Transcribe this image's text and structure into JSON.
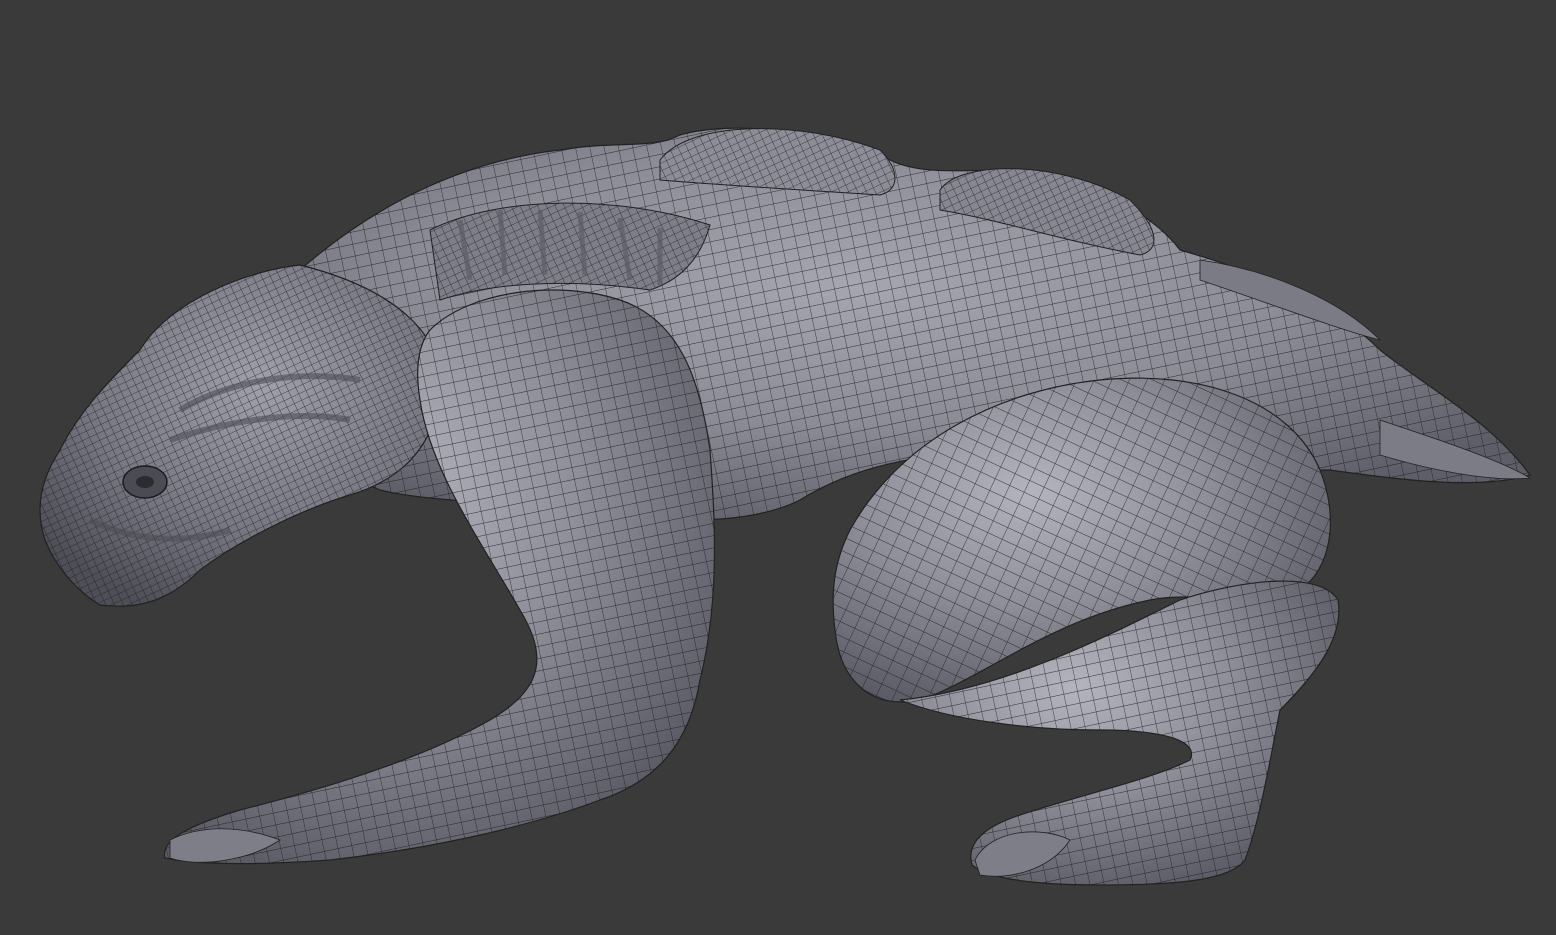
{
  "viewport": {
    "background_color": "#3a3a3a",
    "mesh_fill_color": "#8b8c96",
    "mesh_shadow_color": "#55565e",
    "mesh_highlight_color": "#b9bac4",
    "wire_color": "#1b1b1f",
    "display_mode": "solid-with-wireframe",
    "object": "creature-sculpt-mesh"
  }
}
